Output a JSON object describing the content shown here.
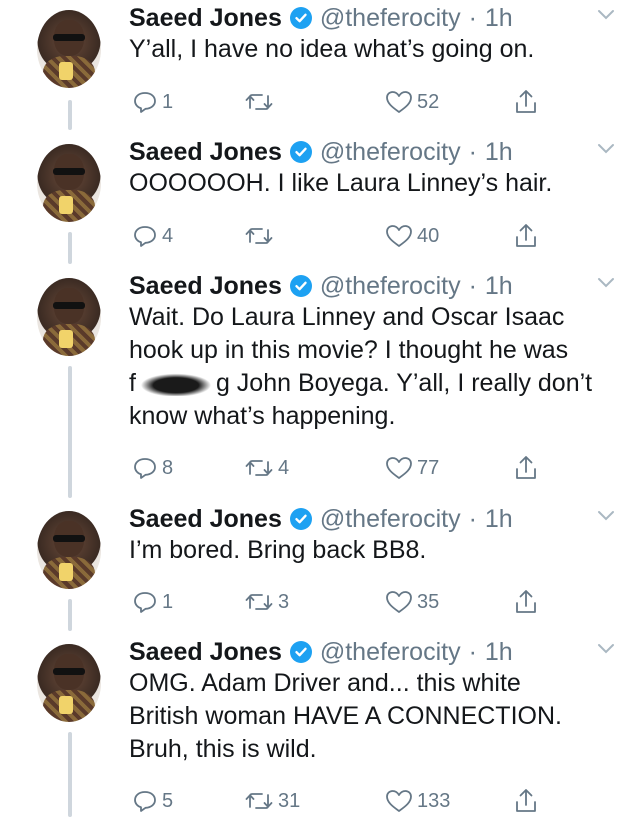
{
  "tweets": [
    {
      "name": "Saeed Jones",
      "handle": "@theferocity",
      "dot": "·",
      "time": "1h",
      "text_lines": [
        "Y’all, I have no idea what’s going on."
      ],
      "replies": "1",
      "retweets": "",
      "likes": "52"
    },
    {
      "name": "Saeed Jones",
      "handle": "@theferocity",
      "dot": "·",
      "time": "1h",
      "text_lines": [
        "OOOOOOH. I like Laura Linney’s hair."
      ],
      "replies": "4",
      "retweets": "",
      "likes": "40"
    },
    {
      "name": "Saeed Jones",
      "handle": "@theferocity",
      "dot": "·",
      "time": "1h",
      "text_lines": [
        "Wait. Do Laura Linney and Oscar Isaac",
        "hook up in this movie? I thought he was",
        "f",
        "g John Boyega. Y’all, I really don’t",
        "know what’s happening."
      ],
      "replies": "8",
      "retweets": "4",
      "likes": "77"
    },
    {
      "name": "Saeed Jones",
      "handle": "@theferocity",
      "dot": "·",
      "time": "1h",
      "text_lines": [
        "I’m bored. Bring back BB8."
      ],
      "replies": "1",
      "retweets": "3",
      "likes": "35"
    },
    {
      "name": "Saeed Jones",
      "handle": "@theferocity",
      "dot": "·",
      "time": "1h",
      "text_lines": [
        "OMG. Adam Driver and... this white",
        "British woman HAVE A CONNECTION.",
        "Bruh, this is wild."
      ],
      "replies": "5",
      "retweets": "31",
      "likes": "133"
    }
  ],
  "icons": {
    "verified": "verified-badge-icon",
    "chevron": "chevron-down-icon",
    "reply": "reply-icon",
    "retweet": "retweet-icon",
    "like": "heart-icon",
    "share": "share-icon"
  },
  "colors": {
    "verified": "#1da1f2",
    "muted": "#657786",
    "thread": "#cfd6dd"
  }
}
